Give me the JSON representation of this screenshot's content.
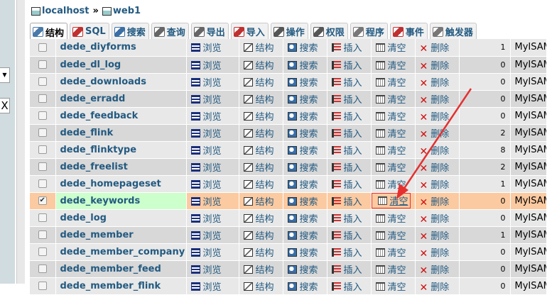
{
  "breadcrumb": {
    "server": "localhost",
    "separator": "»",
    "database": "web1"
  },
  "tabs": [
    {
      "label": "结构",
      "icon": "structure-icon",
      "color": "#4a7aa8"
    },
    {
      "label": "SQL",
      "icon": "sql-icon",
      "color": "#c03030"
    },
    {
      "label": "搜索",
      "icon": "search-icon",
      "color": "#3a6ea5"
    },
    {
      "label": "查询",
      "icon": "query-icon",
      "color": "#666666"
    },
    {
      "label": "导出",
      "icon": "export-icon",
      "color": "#666666"
    },
    {
      "label": "导入",
      "icon": "import-icon",
      "color": "#c03030"
    },
    {
      "label": "操作",
      "icon": "operations-icon",
      "color": "#555555"
    },
    {
      "label": "权限",
      "icon": "privileges-icon",
      "color": "#555555"
    },
    {
      "label": "程序",
      "icon": "routines-icon",
      "color": "#777777"
    },
    {
      "label": "事件",
      "icon": "events-icon",
      "color": "#c03030"
    },
    {
      "label": "触发器",
      "icon": "triggers-icon",
      "color": "#777777"
    }
  ],
  "actions": {
    "browse": "浏览",
    "structure": "结构",
    "search": "搜索",
    "insert": "插入",
    "empty": "清空",
    "drop": "删除"
  },
  "rows": [
    {
      "name": "dede_diyforms",
      "rows": "1",
      "engine": "MyISAM",
      "checked": false
    },
    {
      "name": "dede_dl_log",
      "rows": "0",
      "engine": "MyISAM",
      "checked": false
    },
    {
      "name": "dede_downloads",
      "rows": "0",
      "engine": "MyISAM",
      "checked": false
    },
    {
      "name": "dede_erradd",
      "rows": "0",
      "engine": "MyISAM",
      "checked": false
    },
    {
      "name": "dede_feedback",
      "rows": "0",
      "engine": "MyISAM",
      "checked": false
    },
    {
      "name": "dede_flink",
      "rows": "2",
      "engine": "MyISAM",
      "checked": false
    },
    {
      "name": "dede_flinktype",
      "rows": "8",
      "engine": "MyISAM",
      "checked": false
    },
    {
      "name": "dede_freelist",
      "rows": "2",
      "engine": "MyISAM",
      "checked": false
    },
    {
      "name": "dede_homepageset",
      "rows": "1",
      "engine": "MyISAM",
      "checked": false
    },
    {
      "name": "dede_keywords",
      "rows": "0",
      "engine": "MyISAM",
      "checked": true
    },
    {
      "name": "dede_log",
      "rows": "0",
      "engine": "MyISAM",
      "checked": false
    },
    {
      "name": "dede_member",
      "rows": "1",
      "engine": "MyISAM",
      "checked": false
    },
    {
      "name": "dede_member_company",
      "rows": "0",
      "engine": "MyISAM",
      "checked": false
    },
    {
      "name": "dede_member_feed",
      "rows": "0",
      "engine": "MyISAM",
      "checked": false
    },
    {
      "name": "dede_member_flink",
      "rows": "0",
      "engine": "MyISAM",
      "checked": false
    }
  ],
  "sidebar": {
    "dropdown_glyph": "▼",
    "close_glyph": "X"
  },
  "annotation": {
    "arrow_color": "#e53030"
  }
}
